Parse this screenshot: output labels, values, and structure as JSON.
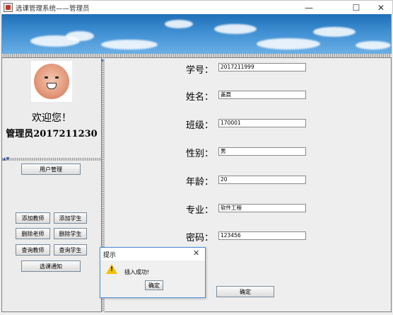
{
  "window": {
    "title": "选课管理系统——管理员",
    "minimize": "—",
    "maximize": "☐",
    "close": "✕"
  },
  "sidebar": {
    "welcome": "欢迎您！",
    "admin_label": "管理员2017211230",
    "buttons": {
      "user_manage": "用户管理",
      "add_teacher": "添加教师",
      "add_student": "添加学生",
      "delete_teacher": "删除老师",
      "delete_student": "删除学生",
      "query_teacher": "查询教师",
      "query_student": "查询学生",
      "course_notice": "选课通知"
    }
  },
  "form": {
    "fields": [
      {
        "label": "学号：",
        "value": "2017211999"
      },
      {
        "label": "姓名：",
        "value": "盖聂"
      },
      {
        "label": "班级：",
        "value": "170001"
      },
      {
        "label": "性别：",
        "value": "男"
      },
      {
        "label": "年龄：",
        "value": "20"
      },
      {
        "label": "专业：",
        "value": "软件工程"
      },
      {
        "label": "密码：",
        "value": "123456"
      }
    ],
    "confirm": "确定"
  },
  "dialog": {
    "title": "提示",
    "close": "✕",
    "message": "插入成功!",
    "ok": "确定",
    "icon": "warning-icon"
  }
}
